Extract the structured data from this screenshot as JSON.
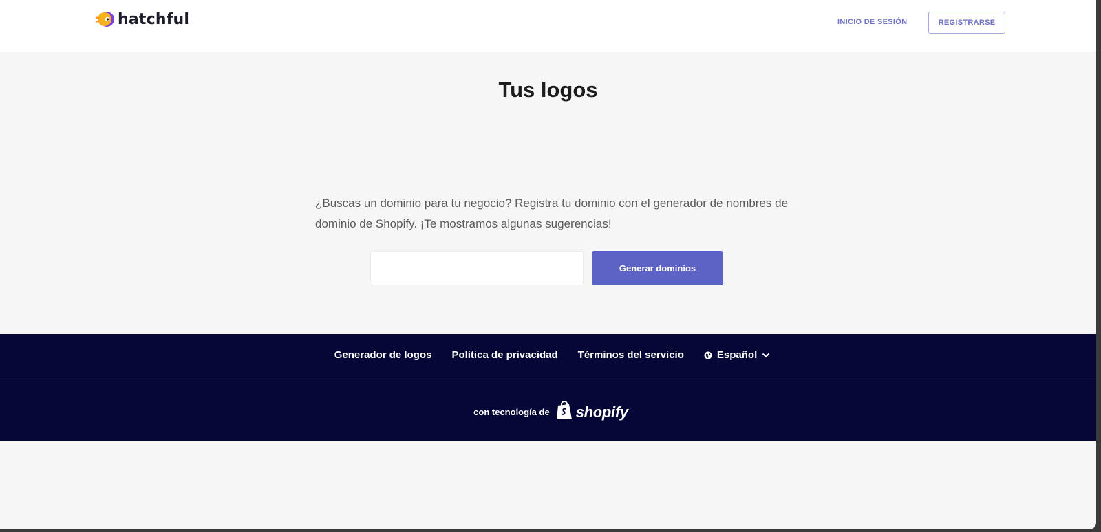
{
  "header": {
    "brand_name": "hatchful",
    "login_label": "INICIO DE SESIÓN",
    "register_label": "REGISTRARSE"
  },
  "main": {
    "title": "Tus logos",
    "domain_text": "¿Buscas un dominio para tu negocio? Registra tu dominio con el generador de nombres de dominio de Shopify. ¡Te mostramos algunas sugerencias!",
    "domain_input_value": "",
    "generate_label": "Generar dominios"
  },
  "footer": {
    "links": [
      "Generador de logos",
      "Política de privacidad",
      "Términos del servicio"
    ],
    "language_label": "Español",
    "powered_by": "con tecnología de",
    "shopify_word": "shopify"
  },
  "colors": {
    "accent": "#5c63c5",
    "footer_bg": "#050836",
    "link": "#6d72c6",
    "page_bg": "#f6f6f6"
  },
  "icons": {
    "brand": "hatchful-logo-icon",
    "language": "globe-icon",
    "dropdown": "chevron-down-icon",
    "shopify": "shopify-bag-icon"
  }
}
